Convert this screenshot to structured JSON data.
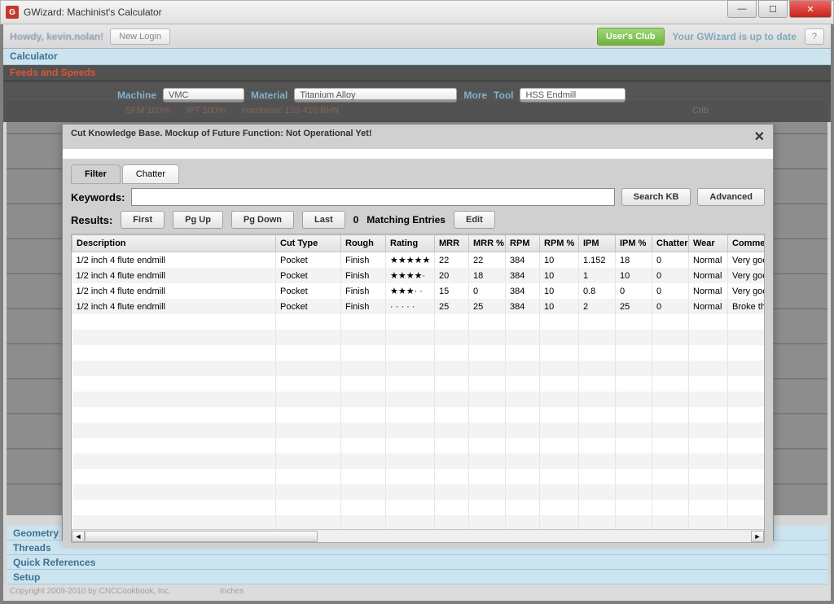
{
  "window": {
    "title": "GWizard: Machinist's Calculator"
  },
  "topbar": {
    "welcome": "Howdy, kevin.nolan!",
    "newlogin": "New Login",
    "usersclub": "User's Club",
    "uptodate": "Your GWizard is up to date",
    "help": "?"
  },
  "nav": {
    "calculator": "Calculator",
    "feeds": "Feeds and Speeds",
    "geometry": "Geometry",
    "threads": "Threads",
    "quickref": "Quick References",
    "setup": "Setup"
  },
  "params": {
    "machine_lbl": "Machine",
    "machine_val": "VMC",
    "material_lbl": "Material",
    "material_val": "Titanium Alloy",
    "more_lbl": "More",
    "tool_lbl": "Tool",
    "tool_val": "HSS Endmill",
    "sfm": "SFM 100%",
    "ipt": "IPT 100%",
    "hardness": "Hardness: 120-410 BHN",
    "crib_lbl": "Crib"
  },
  "footer": {
    "copy": "Copyright 2009-2010 by CNCCookbook, Inc.",
    "units": "Inches"
  },
  "dialog": {
    "title": "Cut Knowledge Base. Mockup of Future Function: Not Operational Yet!",
    "tabs": {
      "filter": "Filter",
      "chatter": "Chatter"
    },
    "keywords_lbl": "Keywords:",
    "searchkb": "Search KB",
    "advanced": "Advanced",
    "results_lbl": "Results:",
    "first": "First",
    "pgup": "Pg Up",
    "pgdown": "Pg Down",
    "last": "Last",
    "count": "0",
    "matching": "Matching Entries",
    "edit": "Edit",
    "columns": [
      "Description",
      "Cut Type",
      "Rough",
      "Rating",
      "MRR",
      "MRR %",
      "RPM",
      "RPM %",
      "IPM",
      "IPM %",
      "Chatter",
      "Wear",
      "Comment"
    ],
    "rows": [
      {
        "desc": "1/2 inch 4 flute endmill",
        "cut": "Pocket",
        "rough": "Finish",
        "rating": "★★★★★",
        "mrr": "22",
        "mrrp": "22",
        "rpm": "384",
        "rpmp": "10",
        "ipm": "1.152",
        "ipmp": "18",
        "chatter": "0",
        "wear": "Normal",
        "comment": "Very good"
      },
      {
        "desc": "1/2 inch 4 flute endmill",
        "cut": "Pocket",
        "rough": "Finish",
        "rating": "★★★★·",
        "mrr": "20",
        "mrrp": "18",
        "rpm": "384",
        "rpmp": "10",
        "ipm": "1",
        "ipmp": "10",
        "chatter": "0",
        "wear": "Normal",
        "comment": "Very good"
      },
      {
        "desc": "1/2 inch 4 flute endmill",
        "cut": "Pocket",
        "rough": "Finish",
        "rating": "★★★· ·",
        "mrr": "15",
        "mrrp": "0",
        "rpm": "384",
        "rpmp": "10",
        "ipm": "0.8",
        "ipmp": "0",
        "chatter": "0",
        "wear": "Normal",
        "comment": "Very good"
      },
      {
        "desc": "1/2 inch 4 flute endmill",
        "cut": "Pocket",
        "rough": "Finish",
        "rating": "· · · · ·",
        "mrr": "25",
        "mrrp": "25",
        "rpm": "384",
        "rpmp": "10",
        "ipm": "2",
        "ipmp": "25",
        "chatter": "0",
        "wear": "Normal",
        "comment": "Broke the"
      }
    ]
  }
}
